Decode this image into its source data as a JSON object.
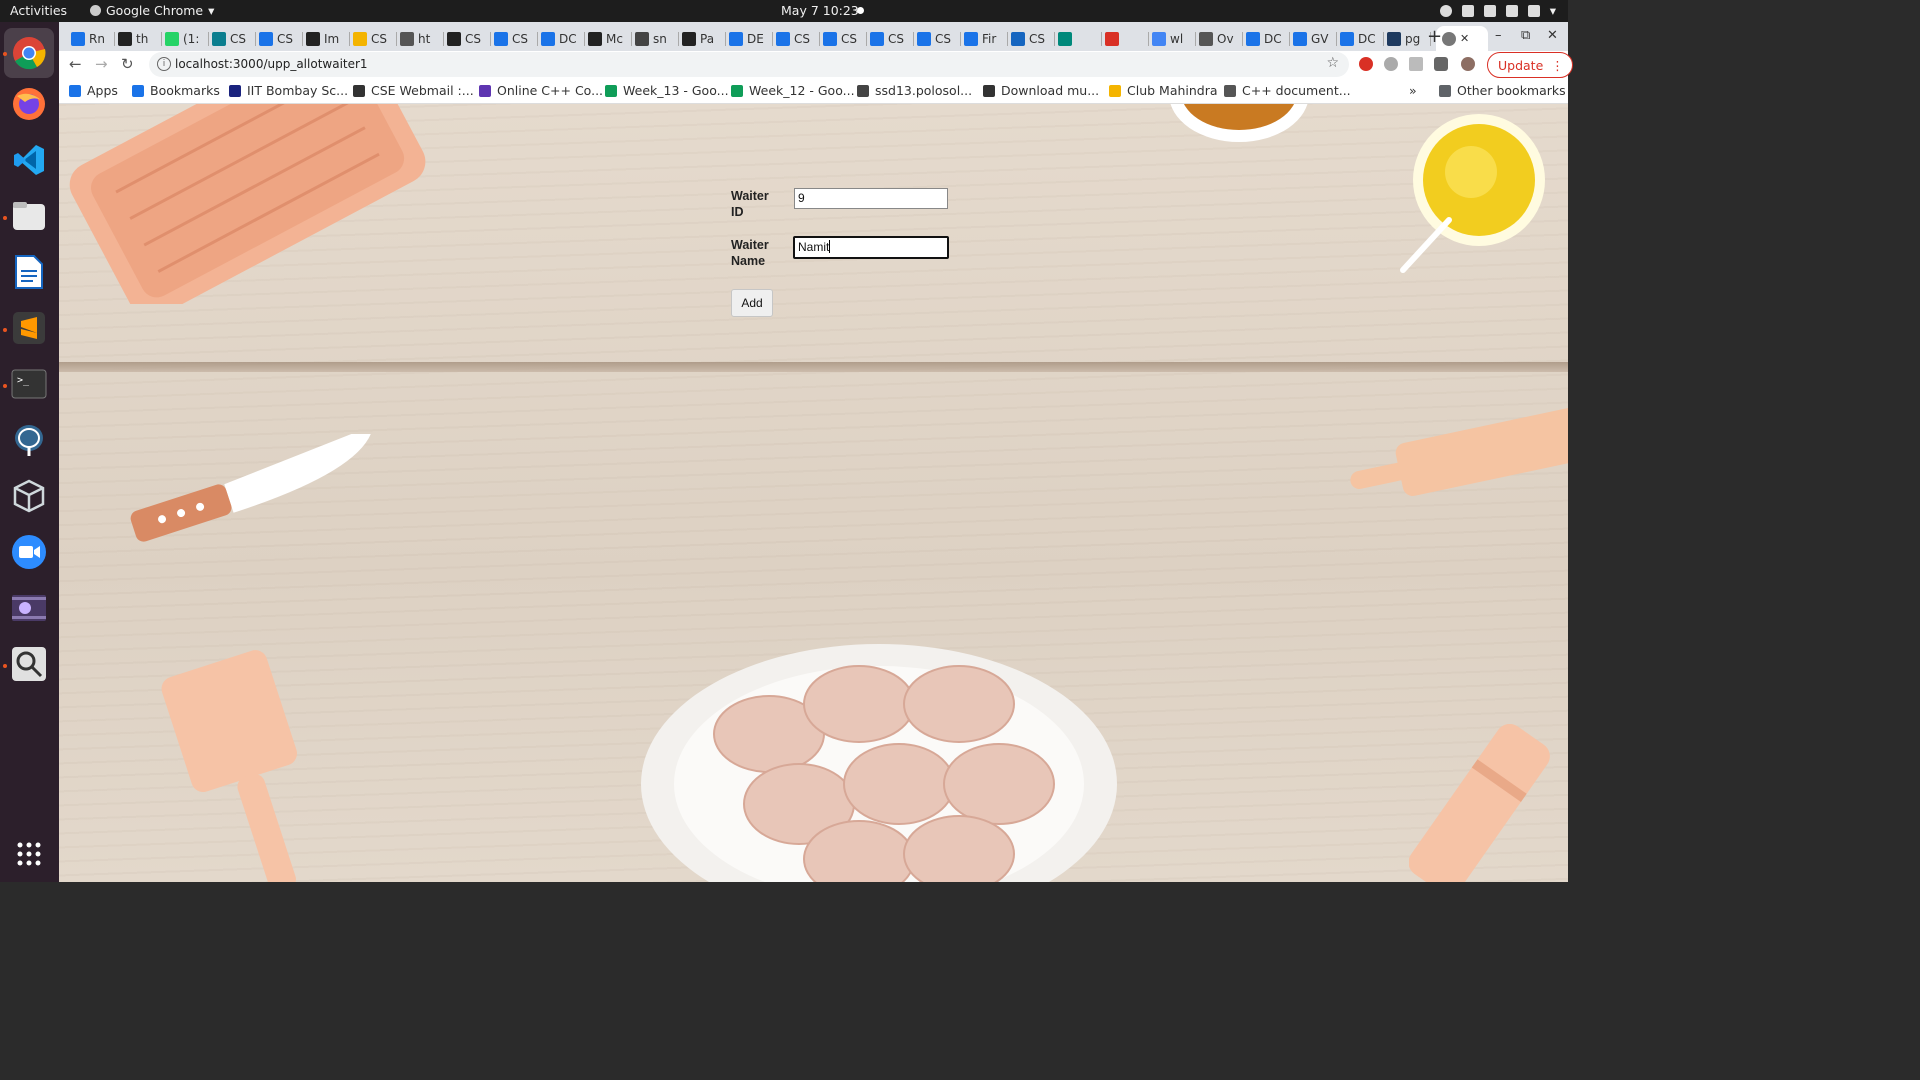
{
  "topbar": {
    "activities": "Activities",
    "app_name": "Google Chrome",
    "clock": "May 7  10:23"
  },
  "dock": {
    "items": [
      "chrome",
      "firefox",
      "vscode",
      "files",
      "libreoffice-writer",
      "sublime-text",
      "terminal",
      "postgresql",
      "virtualbox",
      "zoom",
      "screen-recorder",
      "magnifier",
      "show-apps"
    ]
  },
  "tabs": [
    {
      "label": "Rn",
      "icon": "docs-icon",
      "color": "#1a73e8"
    },
    {
      "label": "th",
      "icon": "github-icon",
      "color": "#222"
    },
    {
      "label": "(1:",
      "icon": "whatsapp-icon",
      "color": "#25d366"
    },
    {
      "label": "CS",
      "icon": "uc-icon",
      "color": "#0b7e8f"
    },
    {
      "label": "CS",
      "icon": "docs-icon",
      "color": "#1a73e8"
    },
    {
      "label": "Im",
      "icon": "github-icon",
      "color": "#222"
    },
    {
      "label": "CS",
      "icon": "slides-icon",
      "color": "#f4b400"
    },
    {
      "label": "ht",
      "icon": "globe-icon",
      "color": "#555"
    },
    {
      "label": "CS",
      "icon": "github-icon",
      "color": "#222"
    },
    {
      "label": "CS",
      "icon": "docs-icon",
      "color": "#1a73e8"
    },
    {
      "label": "DC",
      "icon": "docs-icon",
      "color": "#1a73e8"
    },
    {
      "label": "Mc",
      "icon": "github-icon",
      "color": "#222"
    },
    {
      "label": "sn",
      "icon": "sheet-icon",
      "color": "#444"
    },
    {
      "label": "Pa",
      "icon": "github-icon",
      "color": "#222"
    },
    {
      "label": "DE",
      "icon": "docs-icon",
      "color": "#1a73e8"
    },
    {
      "label": "CS",
      "icon": "docs-icon",
      "color": "#1a73e8"
    },
    {
      "label": "CS",
      "icon": "docs-icon",
      "color": "#1a73e8"
    },
    {
      "label": "CS",
      "icon": "docs-icon",
      "color": "#1a73e8"
    },
    {
      "label": "CS",
      "icon": "docs-icon",
      "color": "#1a73e8"
    },
    {
      "label": "Fir",
      "icon": "docs-icon",
      "color": "#1a73e8"
    },
    {
      "label": "CS",
      "icon": "p-icon",
      "color": "#1565c0"
    },
    {
      "label": "",
      "icon": "meet-icon",
      "color": "#00897b"
    },
    {
      "label": "",
      "icon": "record-icon",
      "color": "#d93025"
    },
    {
      "label": "wl",
      "icon": "google-icon",
      "color": "#4285f4"
    },
    {
      "label": "Ov",
      "icon": "globe-icon",
      "color": "#555"
    },
    {
      "label": "DC",
      "icon": "docs-icon",
      "color": "#1a73e8"
    },
    {
      "label": "GV",
      "icon": "docs-icon",
      "color": "#1a73e8"
    },
    {
      "label": "DC",
      "icon": "docs-icon",
      "color": "#1a73e8"
    },
    {
      "label": "pg",
      "icon": "pg-icon",
      "color": "#1e3a5f"
    }
  ],
  "address_bar": {
    "url": "localhost:3000/upp_allotwaiter1"
  },
  "update_button": "Update",
  "bookmarks": [
    {
      "label": "Apps",
      "icon": "apps-grid-icon",
      "color": "#1a73e8"
    },
    {
      "label": "Bookmarks",
      "icon": "star-icon",
      "color": "#1a73e8"
    },
    {
      "label": "IIT Bombay Sc...",
      "icon": "iitb-icon",
      "color": "#1a237e"
    },
    {
      "label": "CSE Webmail :...",
      "icon": "webmail-icon",
      "color": "#333"
    },
    {
      "label": "Online C++ Co...",
      "icon": "code-icon",
      "color": "#5e35b1"
    },
    {
      "label": "Week_13 - Goo...",
      "icon": "drive-icon",
      "color": "#0f9d58"
    },
    {
      "label": "Week_12 - Goo...",
      "icon": "drive-icon",
      "color": "#0f9d58"
    },
    {
      "label": "ssd13.polosol...",
      "icon": "globe-icon",
      "color": "#444"
    },
    {
      "label": "Download mu...",
      "icon": "download-icon",
      "color": "#333"
    },
    {
      "label": "Club Mahindra",
      "icon": "club-icon",
      "color": "#f4b400"
    },
    {
      "label": "C++ document...",
      "icon": "cpp-icon",
      "color": "#555"
    }
  ],
  "other_bookmarks": "Other bookmarks",
  "form": {
    "waiter_id_label": "Waiter ID",
    "waiter_id_value": "9",
    "waiter_name_label": "Waiter Name",
    "waiter_name_value": "Namit",
    "add_button": "Add"
  }
}
